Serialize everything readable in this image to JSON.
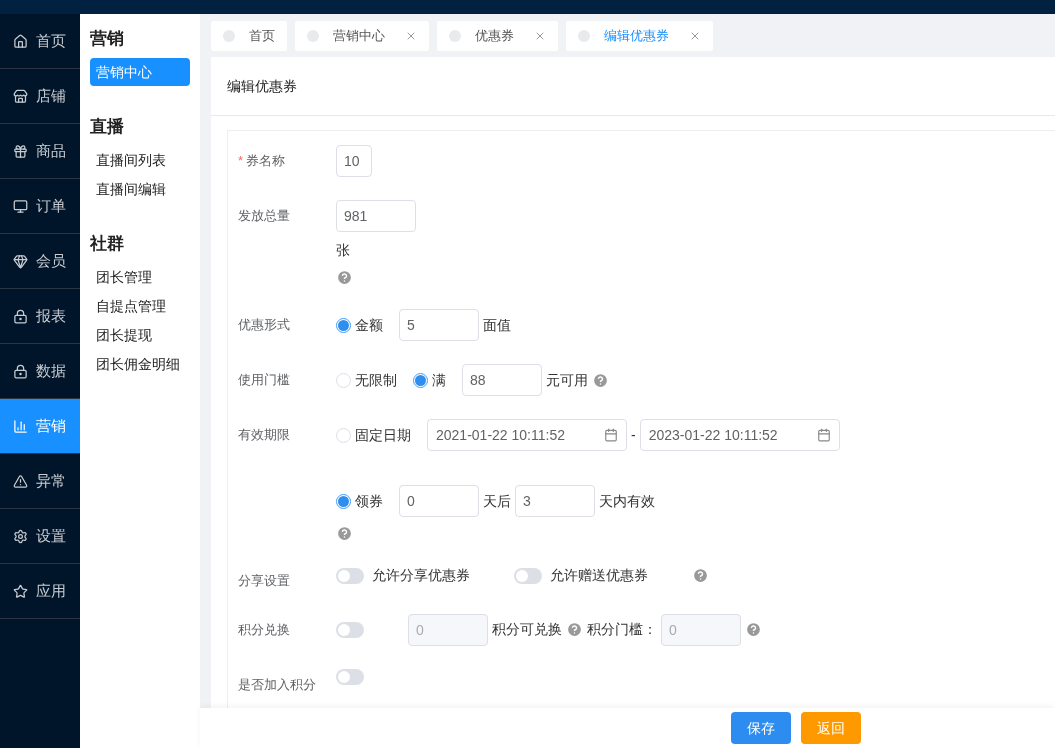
{
  "nav": [
    {
      "label": "首页",
      "selected": false
    },
    {
      "label": "店铺",
      "selected": false
    },
    {
      "label": "商品",
      "selected": false
    },
    {
      "label": "订单",
      "selected": false
    },
    {
      "label": "会员",
      "selected": false
    },
    {
      "label": "报表",
      "selected": false
    },
    {
      "label": "数据",
      "selected": false
    },
    {
      "label": "营销",
      "selected": true
    },
    {
      "label": "异常",
      "selected": false
    },
    {
      "label": "设置",
      "selected": false
    },
    {
      "label": "应用",
      "selected": false
    }
  ],
  "submenu": [
    {
      "title": "营销",
      "items": [
        {
          "label": "营销中心",
          "selected": true
        }
      ]
    },
    {
      "title": "直播",
      "items": [
        {
          "label": "直播间列表",
          "selected": false
        },
        {
          "label": "直播间编辑",
          "selected": false
        }
      ]
    },
    {
      "title": "社群",
      "items": [
        {
          "label": "团长管理",
          "selected": false
        },
        {
          "label": "自提点管理",
          "selected": false
        },
        {
          "label": "团长提现",
          "selected": false
        },
        {
          "label": "团长佣金明细",
          "selected": false
        }
      ]
    }
  ],
  "tabs": [
    {
      "label": "首页",
      "closable": false,
      "selected": false
    },
    {
      "label": "营销中心",
      "closable": true,
      "selected": false
    },
    {
      "label": "优惠券",
      "closable": true,
      "selected": false
    },
    {
      "label": "编辑优惠券",
      "closable": true,
      "selected": true
    }
  ],
  "page_title": "编辑优惠券",
  "form": [
    {
      "label": "券名称",
      "required_mark": "*",
      "lines": [
        [
          {
            "kind": "input",
            "value": "10"
          }
        ]
      ]
    },
    {
      "label": "发放总量",
      "lines": [
        [
          {
            "kind": "input",
            "value": "981"
          }
        ],
        [
          {
            "kind": "text",
            "text": "张"
          }
        ],
        [
          {
            "kind": "help"
          }
        ]
      ]
    },
    {
      "label": "优惠形式",
      "lines": [
        [
          {
            "kind": "radio",
            "text": "金额",
            "selected": true
          },
          {
            "kind": "input",
            "value": "5"
          },
          {
            "kind": "text",
            "text": "面值"
          }
        ]
      ]
    },
    {
      "label": "使用门槛",
      "lines": [
        [
          {
            "kind": "radio",
            "text": "无限制",
            "selected": false
          },
          {
            "kind": "radio",
            "text": "满",
            "selected": true
          },
          {
            "kind": "input",
            "value": "88"
          },
          {
            "kind": "text",
            "text": "元可用"
          },
          {
            "kind": "help"
          }
        ]
      ]
    },
    {
      "label": "有效期限",
      "lines": [
        [
          {
            "kind": "radio",
            "text": "固定日期",
            "selected": false
          },
          {
            "kind": "date",
            "value": "2021-01-22 10:11:52"
          },
          {
            "kind": "text",
            "text": "-"
          },
          {
            "kind": "date",
            "value": "2023-01-22 10:11:52"
          }
        ],
        [
          {
            "kind": "radio",
            "text": "领券",
            "selected": true
          },
          {
            "kind": "input",
            "value": "0"
          },
          {
            "kind": "text",
            "text": "天后"
          },
          {
            "kind": "input",
            "value": "3"
          },
          {
            "kind": "text",
            "text": "天内有效"
          }
        ],
        [
          {
            "kind": "help"
          }
        ]
      ]
    },
    {
      "label": "分享设置",
      "lines": [
        [
          {
            "kind": "toggle",
            "text": "允许分享优惠券",
            "on": false
          },
          {
            "kind": "toggle",
            "text": "允许赠送优惠券",
            "on": false
          },
          {
            "kind": "help"
          }
        ]
      ]
    },
    {
      "label": "积分兑换",
      "lines": [
        [
          {
            "kind": "toggle",
            "on": false
          },
          {
            "kind": "input",
            "value": "0",
            "disabled": true
          },
          {
            "kind": "text",
            "text": "积分可兑换"
          },
          {
            "kind": "help"
          },
          {
            "kind": "text",
            "text": "积分门槛："
          },
          {
            "kind": "input",
            "value": "0",
            "disabled": true
          },
          {
            "kind": "help"
          }
        ]
      ]
    },
    {
      "label": "是否加入积分",
      "lines": [
        [
          {
            "kind": "toggle",
            "on": false
          }
        ]
      ]
    }
  ],
  "buttons": [
    {
      "label": "保存",
      "kind": "primary"
    },
    {
      "label": "返回",
      "kind": "warning"
    }
  ]
}
